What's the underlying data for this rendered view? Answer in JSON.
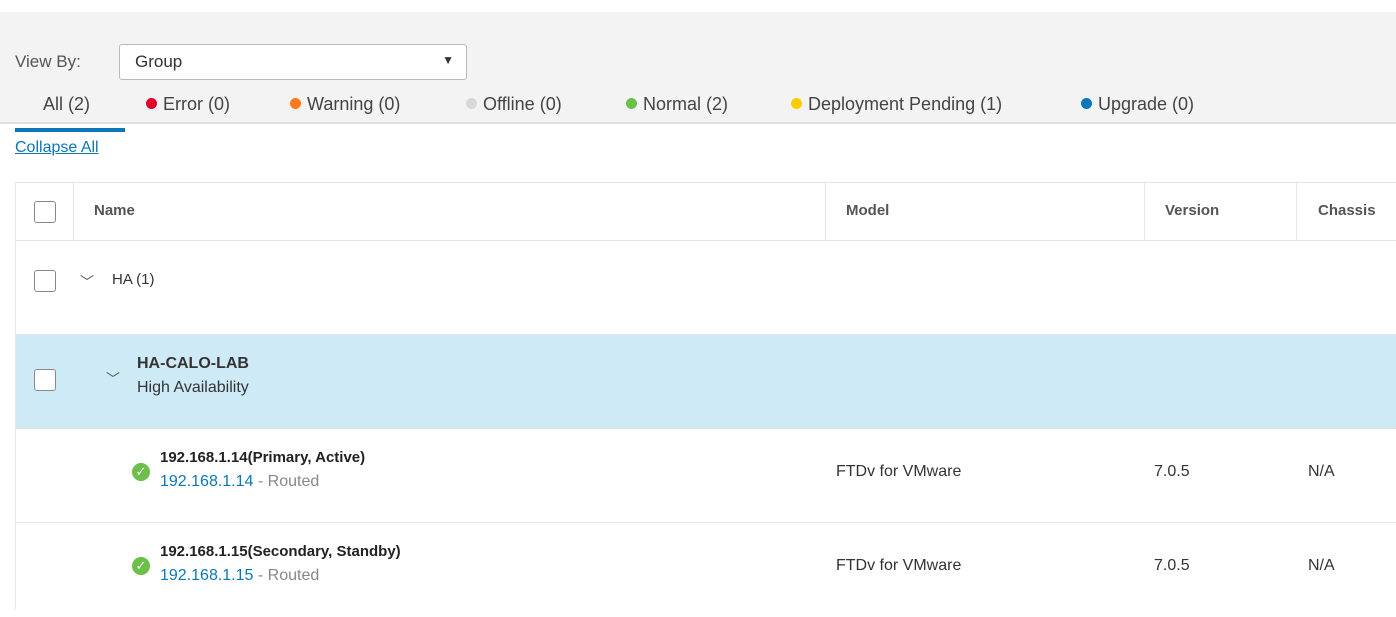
{
  "filters": {
    "view_by_label": "View By:",
    "view_by_value": "Group"
  },
  "tabs": [
    {
      "label": "All (2)",
      "dot_color": ""
    },
    {
      "label": "Error (0)",
      "dot_color": "#e0002a"
    },
    {
      "label": "Warning (0)",
      "dot_color": "#ff7a1a"
    },
    {
      "label": "Offline (0)",
      "dot_color": "#d8d8d8"
    },
    {
      "label": "Normal (2)",
      "dot_color": "#6cc04a"
    },
    {
      "label": "Deployment Pending (1)",
      "dot_color": "#ffcc00"
    },
    {
      "label": "Upgrade (0)",
      "dot_color": "#0b77b8"
    }
  ],
  "collapse_all": "Collapse All",
  "table": {
    "headers": {
      "name": "Name",
      "model": "Model",
      "version": "Version",
      "chassis": "Chassis"
    },
    "group": {
      "label": "HA (1)"
    },
    "ha": {
      "name": "HA-CALO-LAB",
      "subtitle": "High Availability"
    },
    "devices": [
      {
        "title": "192.168.1.14(Primary, Active)",
        "ip": "192.168.1.14",
        "mode": "- Routed",
        "model": "FTDv for VMware",
        "version": "7.0.5",
        "chassis": "N/A"
      },
      {
        "title": "192.168.1.15(Secondary, Standby)",
        "ip": "192.168.1.15",
        "mode": "- Routed",
        "model": "FTDv for VMware",
        "version": "7.0.5",
        "chassis": "N/A"
      }
    ]
  },
  "colors": {
    "accent": "#0b77b8",
    "ha_row_bg": "#cfeaf7",
    "status_ok": "#6cc04a"
  }
}
